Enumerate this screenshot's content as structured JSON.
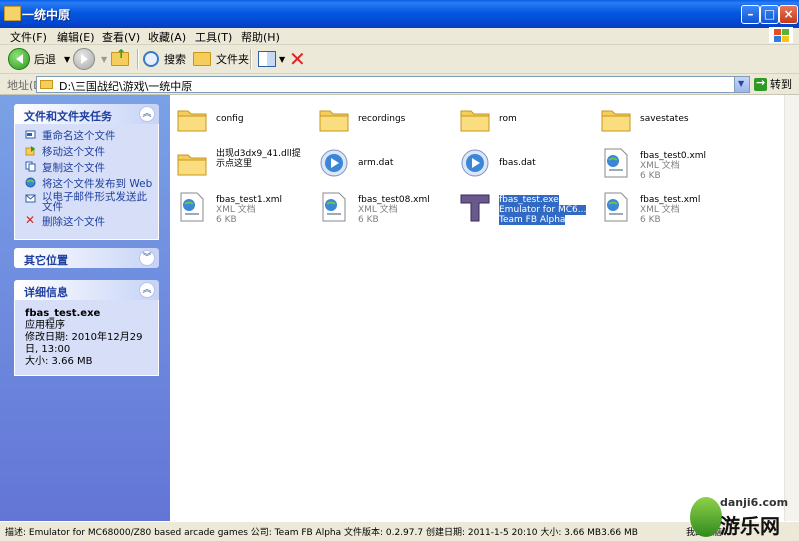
{
  "window": {
    "title": "一统中原"
  },
  "menu": [
    "文件(F)",
    "编辑(E)",
    "查看(V)",
    "收藏(A)",
    "工具(T)",
    "帮助(H)"
  ],
  "toolbar": {
    "back": "后退",
    "search": "搜索",
    "folders": "文件夹"
  },
  "address": {
    "label": "地址(D)",
    "path": "D:\\三国战纪\\游戏\\一统中原",
    "go": "转到"
  },
  "tasks_panel": {
    "title": "文件和文件夹任务",
    "items": [
      "重命名这个文件",
      "移动这个文件",
      "复制这个文件",
      "将这个文件发布到 Web",
      "以电子邮件形式发送此文件",
      "删除这个文件"
    ]
  },
  "other_panel": {
    "title": "其它位置"
  },
  "details_panel": {
    "title": "详细信息",
    "filename": "fbas_test.exe",
    "type": "应用程序",
    "modified": "修改日期: 2010年12月29日, 13:00",
    "size": "大小: 3.66 MB"
  },
  "files": [
    {
      "name": "config",
      "kind": "folder"
    },
    {
      "name": "recordings",
      "kind": "folder"
    },
    {
      "name": "rom",
      "kind": "folder"
    },
    {
      "name": "savestates",
      "kind": "folder"
    },
    {
      "name": "出现d3dx9_41.dll提示点这里",
      "kind": "folder"
    },
    {
      "name": "arm.dat",
      "kind": "media"
    },
    {
      "name": "fbas.dat",
      "kind": "media"
    },
    {
      "name": "fbas_test0.xml",
      "kind": "xml",
      "type": "XML 文档",
      "size": "6 KB"
    },
    {
      "name": "fbas_test1.xml",
      "kind": "xml",
      "type": "XML 文档",
      "size": "6 KB"
    },
    {
      "name": "fbas_test08.xml",
      "kind": "xml",
      "type": "XML 文档",
      "size": "6 KB"
    },
    {
      "name": "fbas_test.exe",
      "kind": "exe",
      "type": "Emulator for MC6...",
      "size": "Team FB Alpha",
      "selected": true
    },
    {
      "name": "fbas_test.xml",
      "kind": "xml",
      "type": "XML 文档",
      "size": "6 KB"
    }
  ],
  "status": {
    "text": "描述: Emulator for MC68000/Z80 based arcade games 公司: Team FB Alpha 文件版本: 0.2.97.7 创建日期: 2011-1-5 20:10 大小: 3.66 MB3.66 MB",
    "location": "我的电脑"
  },
  "watermark": {
    "domain": "danji6.com",
    "brand": "游乐网"
  },
  "colors": {
    "title_blue": "#0558e0",
    "selection": "#316ac5",
    "panel_bg": "#d6dff7"
  }
}
